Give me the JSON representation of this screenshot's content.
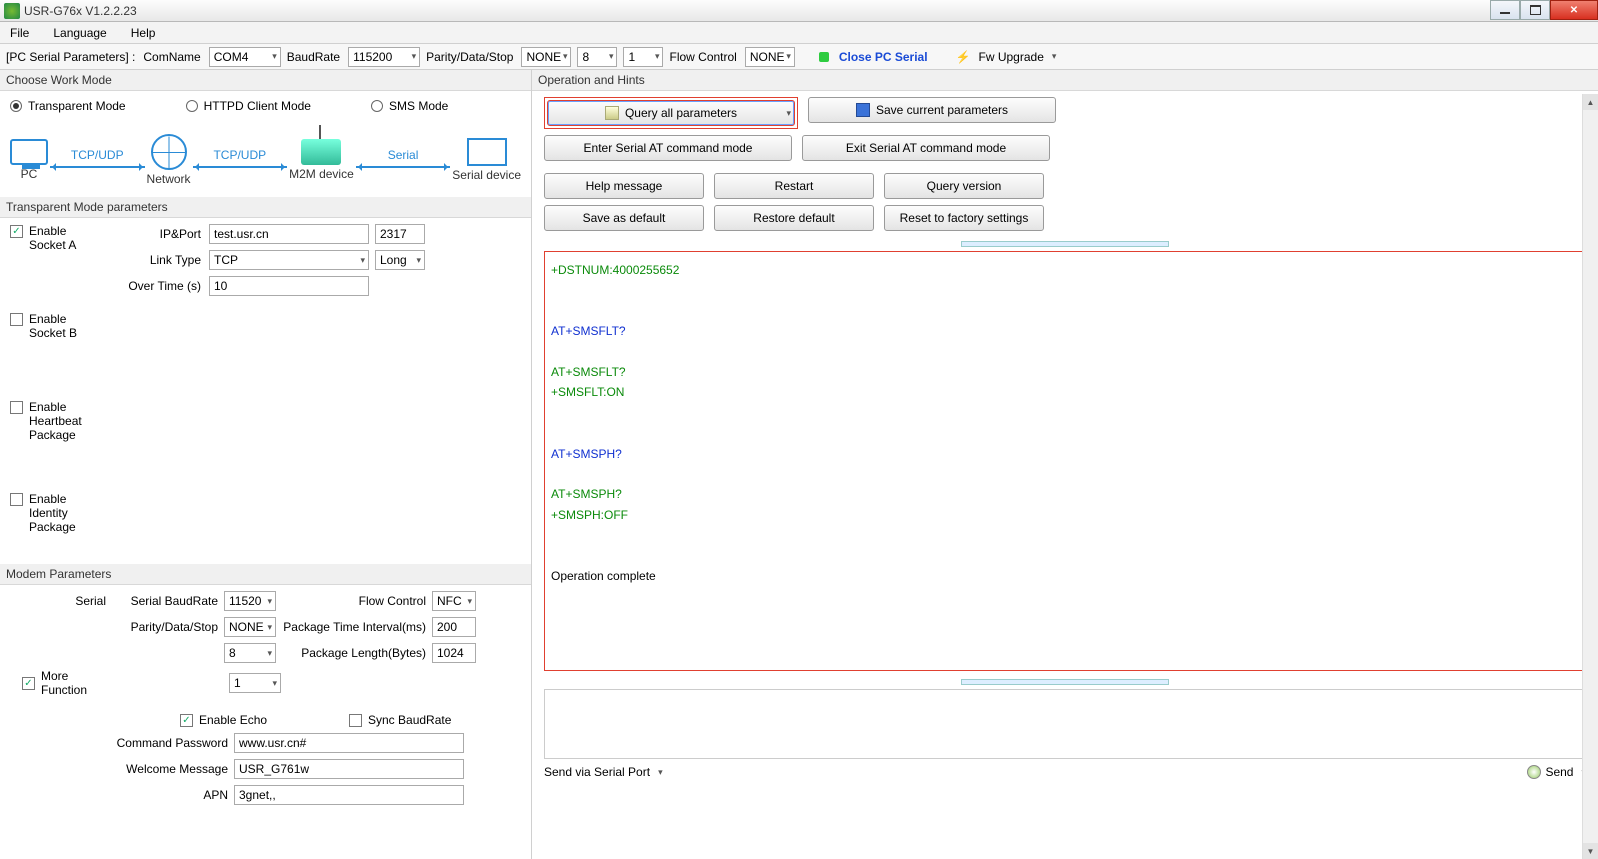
{
  "app": {
    "title": "USR-G76x V1.2.2.23"
  },
  "menu": {
    "file": "File",
    "language": "Language",
    "help": "Help"
  },
  "toolbar": {
    "serial_params_label": "[PC Serial Parameters] :",
    "comname_label": "ComName",
    "comname": "COM4",
    "baud_label": "BaudRate",
    "baud": "115200",
    "pds_label": "Parity/Data/Stop",
    "parity": "NONE",
    "data": "8",
    "stop": "1",
    "flow_label": "Flow Control",
    "flow": "NONE",
    "close_serial": "Close PC Serial",
    "fw_upgrade": "Fw Upgrade"
  },
  "left": {
    "choose_mode": "Choose Work Mode",
    "modes": {
      "transparent": "Transparent Mode",
      "httpd": "HTTPD Client Mode",
      "sms": "SMS Mode"
    },
    "diagram": {
      "pc": "PC",
      "net": "Network",
      "m2m": "M2M device",
      "serial": "Serial device",
      "tcpudp": "TCP/UDP",
      "serial_lbl": "Serial"
    },
    "tp_params": "Transparent Mode parameters",
    "socketA": {
      "enable": "Enable Socket A",
      "ipport_lbl": "IP&Port",
      "ip": "test.usr.cn",
      "port": "2317",
      "link_lbl": "Link Type",
      "link": "TCP",
      "long": "Long",
      "over_lbl": "Over Time (s)",
      "over": "10"
    },
    "socketB": {
      "enable": "Enable Socket B"
    },
    "heartbeat": {
      "enable": "Enable Heartbeat Package"
    },
    "identity": {
      "enable": "Enable Identity Package"
    },
    "modem_params": "Modem Parameters",
    "serial_lbl": "Serial",
    "modem": {
      "baud_lbl": "Serial BaudRate",
      "baud": "11520",
      "flow_lbl": "Flow Control",
      "flow": "NFC",
      "pds_lbl": "Parity/Data/Stop",
      "parity": "NONE",
      "pti_lbl": "Package Time Interval(ms)",
      "pti": "200",
      "data": "8",
      "plb_lbl": "Package Length(Bytes)",
      "plb": "1024",
      "stop": "1"
    },
    "more_fn": "More Function",
    "echo": "Enable Echo",
    "sync": "Sync BaudRate",
    "cmdpwd_lbl": "Command Password",
    "cmdpwd": "www.usr.cn#",
    "welcome_lbl": "Welcome Message",
    "welcome": "USR_G761w",
    "apn_lbl": "APN",
    "apn": "3gnet,,"
  },
  "right": {
    "ops": "Operation and Hints",
    "btns": {
      "query": "Query all parameters",
      "save": "Save current parameters",
      "enter_at": "Enter Serial AT command mode",
      "exit_at": "Exit Serial AT command mode",
      "help": "Help message",
      "restart": "Restart",
      "qver": "Query version",
      "savedef": "Save as default",
      "restore": "Restore default",
      "factory": "Reset to factory settings"
    },
    "log": [
      {
        "c": "g",
        "t": "+DSTNUM:4000255652"
      },
      {
        "c": "",
        "t": ""
      },
      {
        "c": "",
        "t": ""
      },
      {
        "c": "b",
        "t": "AT+SMSFLT?"
      },
      {
        "c": "",
        "t": ""
      },
      {
        "c": "g",
        "t": "AT+SMSFLT?"
      },
      {
        "c": "g",
        "t": "+SMSFLT:ON"
      },
      {
        "c": "",
        "t": ""
      },
      {
        "c": "",
        "t": ""
      },
      {
        "c": "b",
        "t": "AT+SMSPH?"
      },
      {
        "c": "",
        "t": ""
      },
      {
        "c": "g",
        "t": "AT+SMSPH?"
      },
      {
        "c": "g",
        "t": "+SMSPH:OFF"
      },
      {
        "c": "",
        "t": ""
      },
      {
        "c": "",
        "t": ""
      },
      {
        "c": "k",
        "t": "Operation complete"
      }
    ],
    "send_via": "Send via Serial Port",
    "send_btn": "Send"
  }
}
